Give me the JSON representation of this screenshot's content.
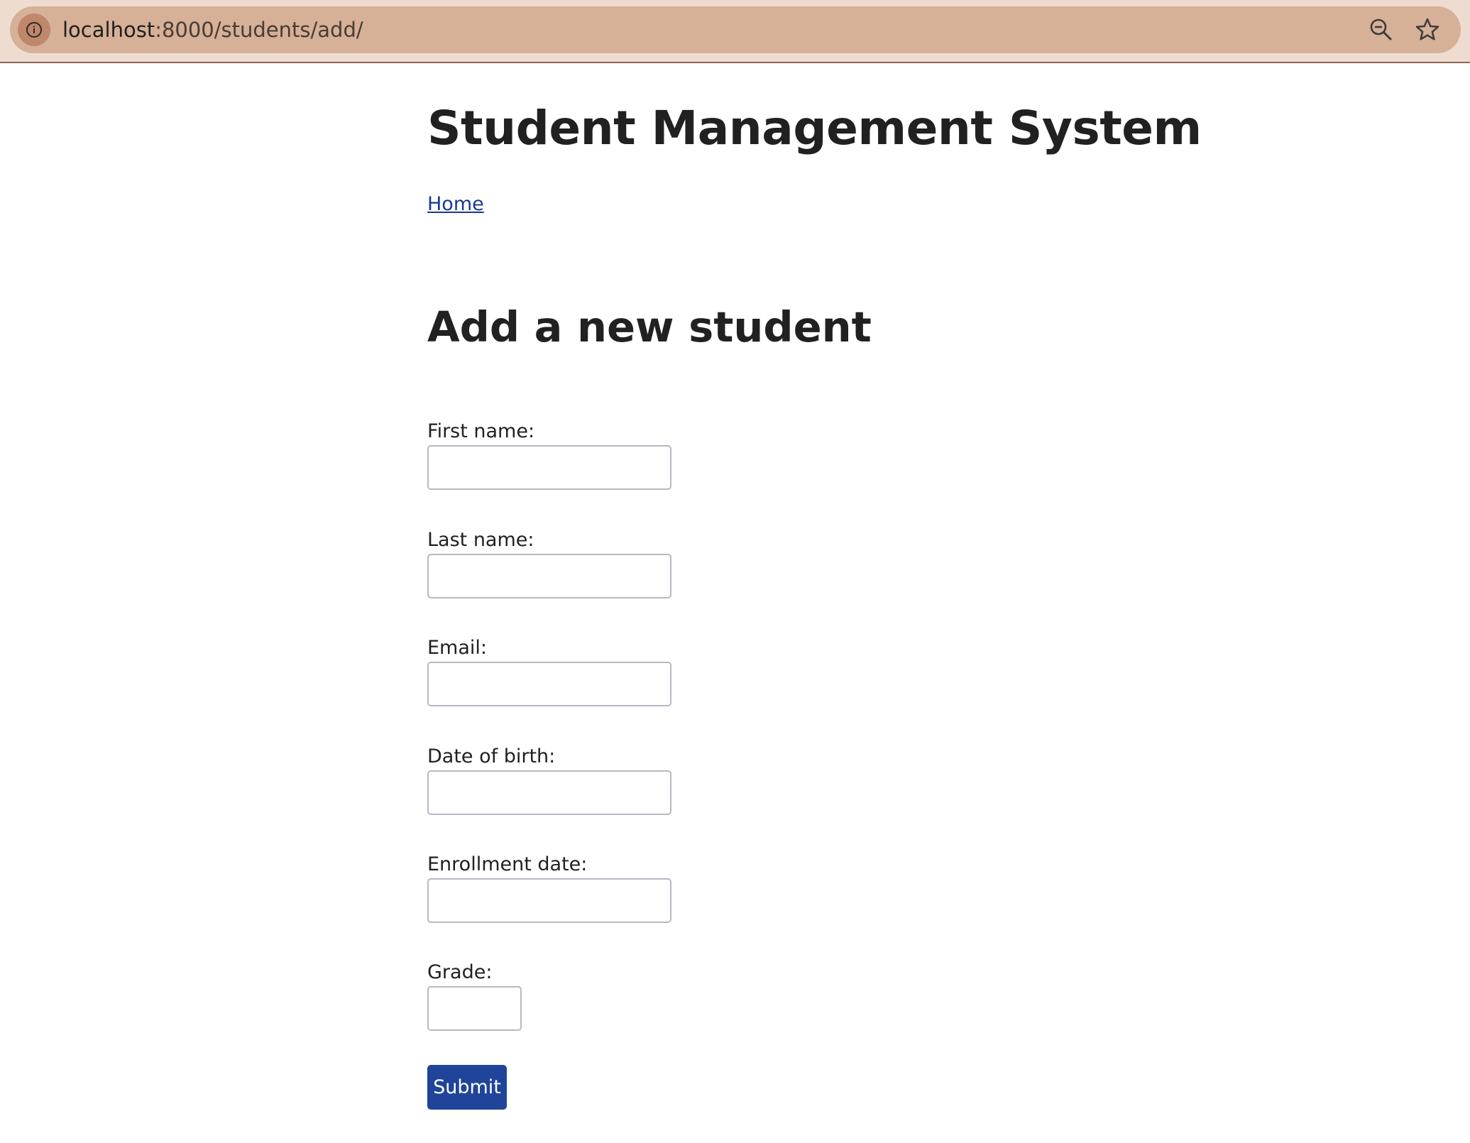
{
  "browser": {
    "url_host": "localhost",
    "url_rest": ":8000/students/add/",
    "site_info_icon": "info-icon",
    "zoom_icon": "zoom-out-icon",
    "bookmark_icon": "star-icon"
  },
  "header": {
    "title": "Student Management System",
    "home_link": "Home"
  },
  "form": {
    "title": "Add a new student",
    "fields": [
      {
        "label": "First name:",
        "value": ""
      },
      {
        "label": "Last name:",
        "value": ""
      },
      {
        "label": "Email:",
        "value": ""
      },
      {
        "label": "Date of birth:",
        "value": ""
      },
      {
        "label": "Enrollment date:",
        "value": ""
      },
      {
        "label": "Grade:",
        "value": ""
      }
    ],
    "submit_label": "Submit"
  },
  "colors": {
    "toolbar_bg": "#efdcd1",
    "omnibox_bg": "#d6b097",
    "link": "#1a3a8f",
    "submit_bg": "#1f4499"
  }
}
